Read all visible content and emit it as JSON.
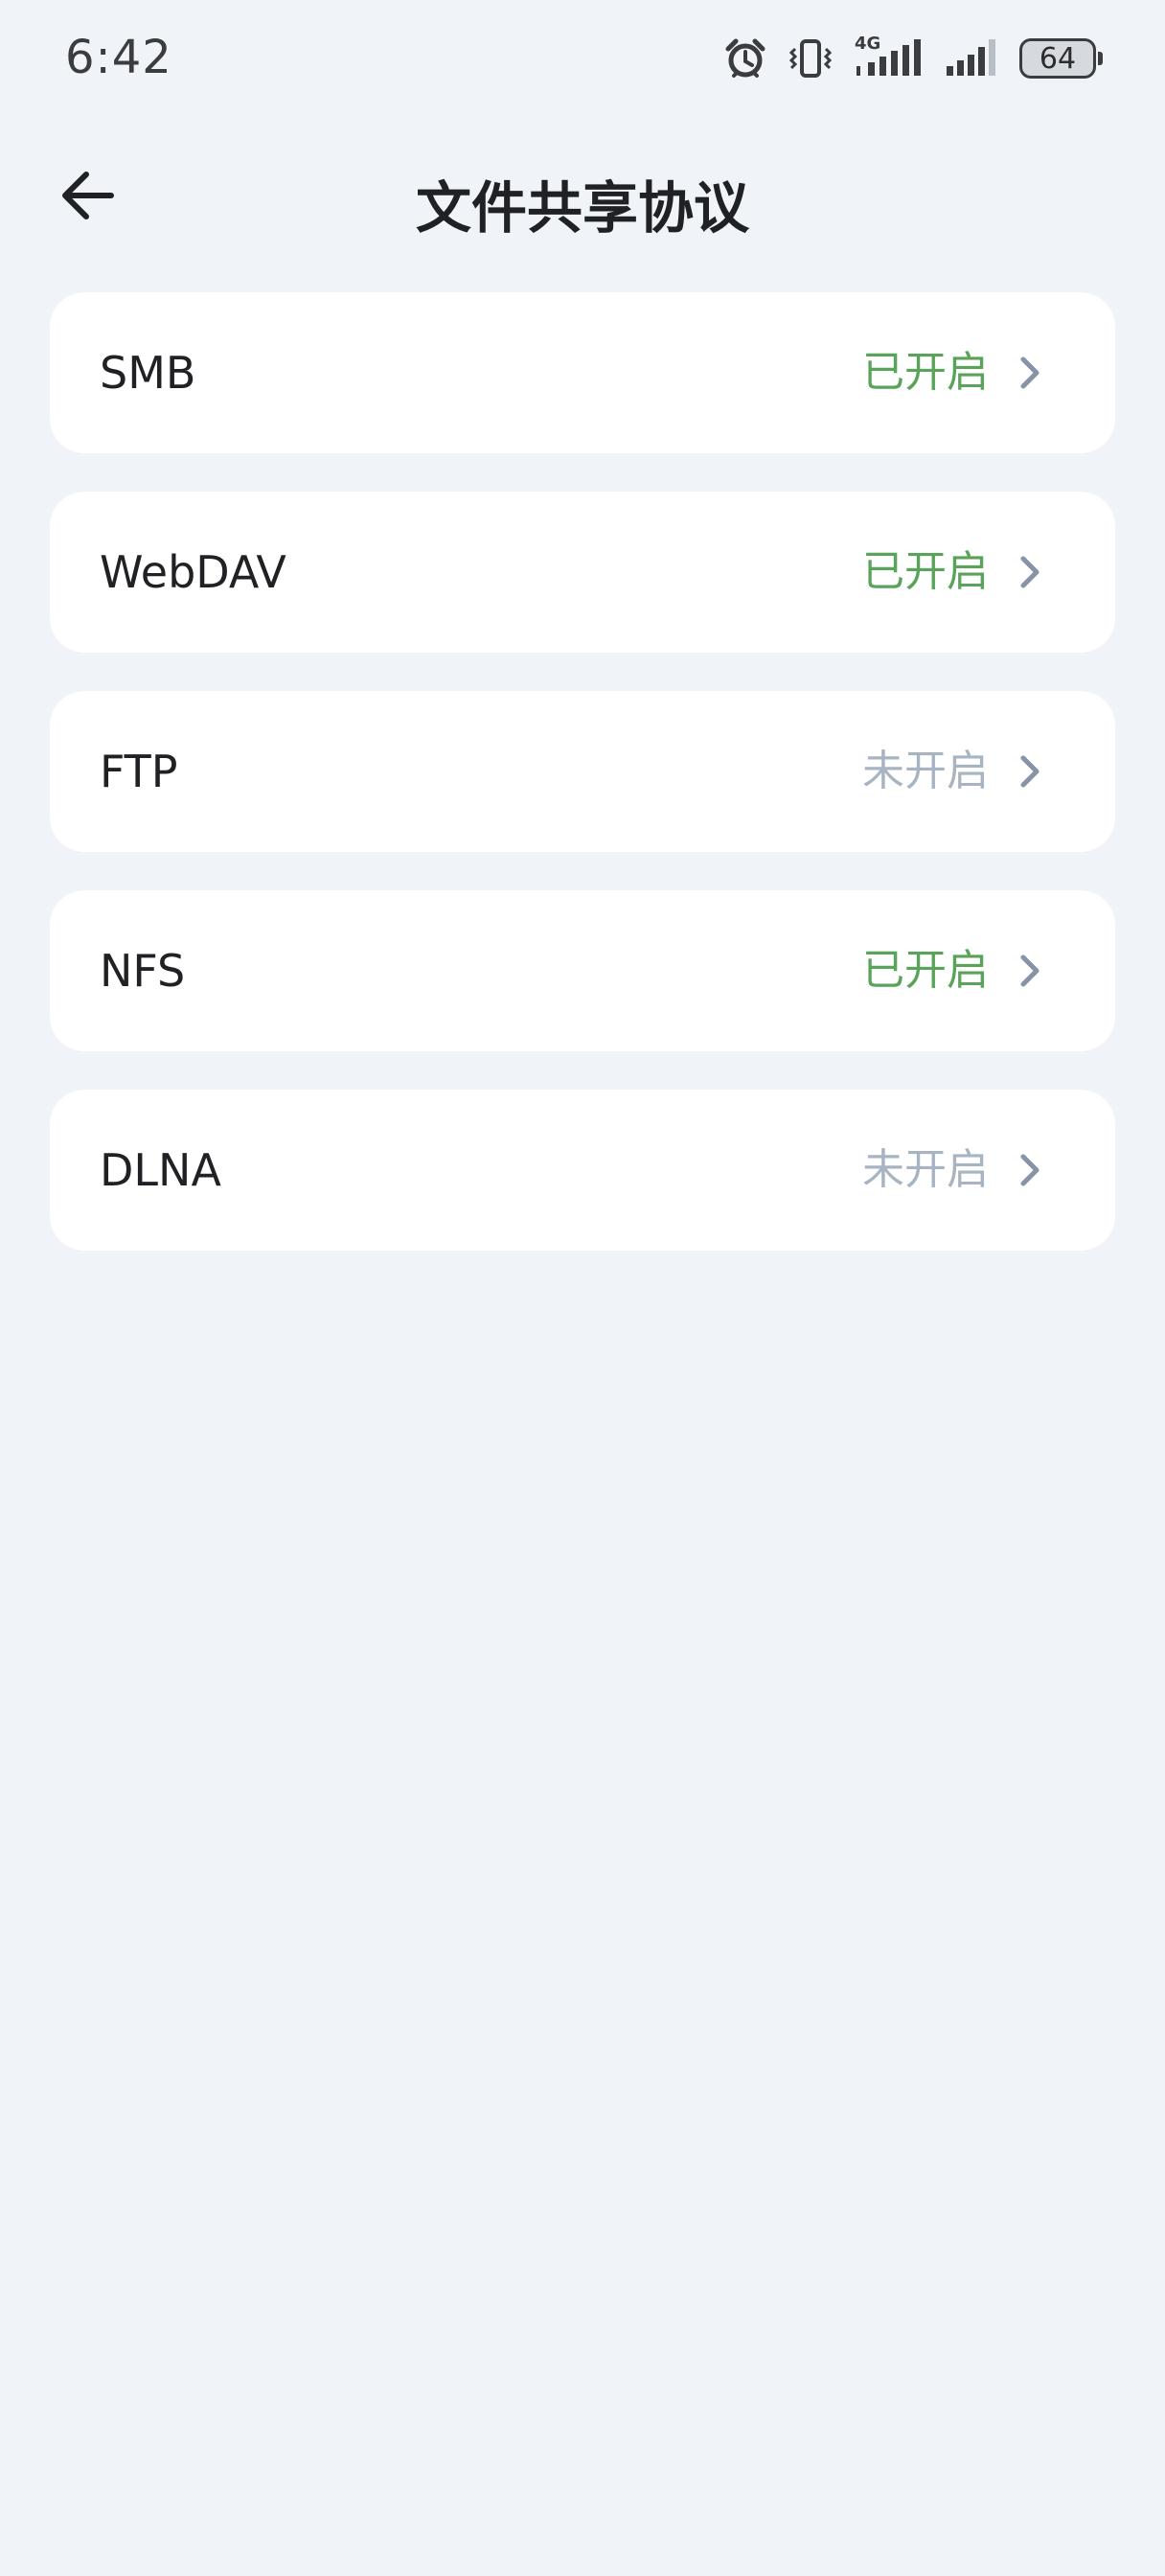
{
  "status_bar": {
    "time": "6:42",
    "network_label": "4G",
    "battery_level": "64",
    "icons": [
      "alarm-icon",
      "vibrate-icon",
      "signal-4g-icon",
      "signal-icon",
      "battery-icon"
    ]
  },
  "header": {
    "title": "文件共享协议",
    "back_icon": "arrow-left-icon"
  },
  "colors": {
    "enabled": "#5aa35a",
    "disabled": "#a9b4c2",
    "background": "#f0f3f8",
    "card": "#ffffff"
  },
  "protocols": [
    {
      "name": "SMB",
      "status": "已开启",
      "enabled": true
    },
    {
      "name": "WebDAV",
      "status": "已开启",
      "enabled": true
    },
    {
      "name": "FTP",
      "status": "未开启",
      "enabled": false
    },
    {
      "name": "NFS",
      "status": "已开启",
      "enabled": true
    },
    {
      "name": "DLNA",
      "status": "未开启",
      "enabled": false
    }
  ]
}
